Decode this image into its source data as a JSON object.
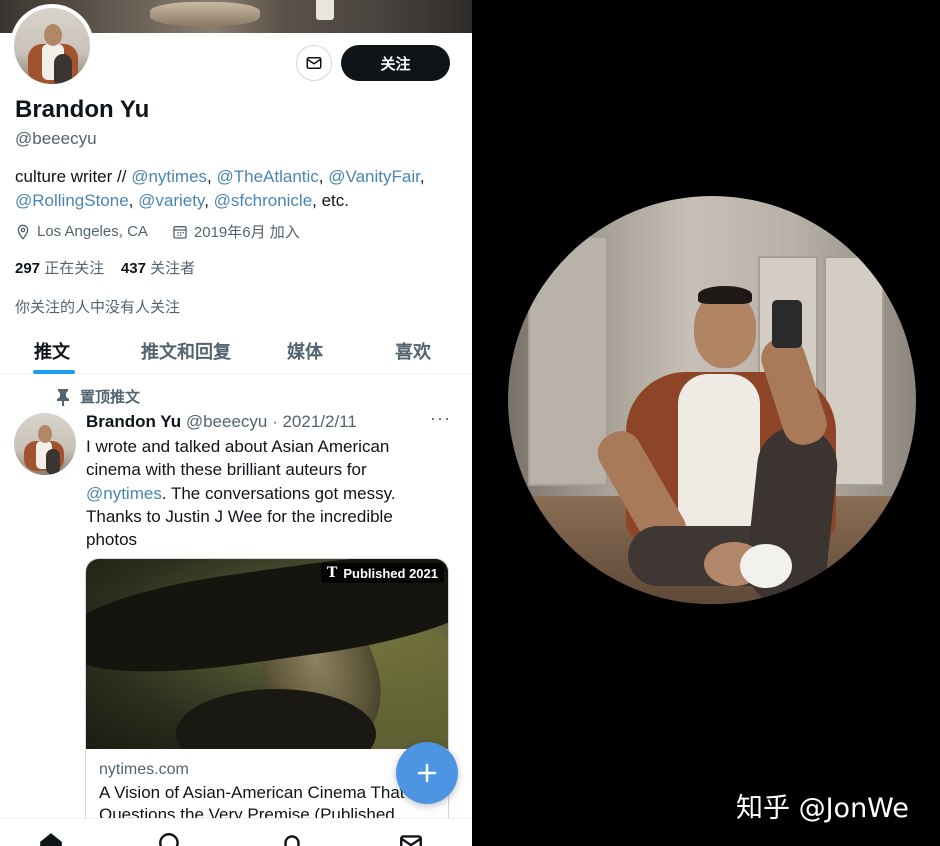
{
  "profile": {
    "name": "Brandon Yu",
    "handle": "@beeecyu",
    "follow_label": "关注",
    "bio_parts": {
      "p1": "culture writer // ",
      "l1": "@nytimes",
      "s1": ", ",
      "l2": "@TheAtlantic",
      "s2": ", ",
      "l3": "@VanityFair",
      "s3": ",",
      "l4": "@RollingStone",
      "s4": ", ",
      "l5": "@variety",
      "s5": ", ",
      "l6": "@sfchronicle",
      "s6": ", etc."
    },
    "location": "Los Angeles, CA",
    "joined": "2019年6月 加入",
    "following_count": "297",
    "following_label": "正在关注",
    "followers_count": "437",
    "followers_label": "关注者",
    "followed_note": "你关注的人中没有人关注"
  },
  "tabs": [
    "推文",
    "推文和回复",
    "媒体",
    "喜欢"
  ],
  "tweet": {
    "pinned_label": "置顶推文",
    "author": "Brandon Yu",
    "meta": "@beeecyu · 2021/2/11",
    "text1": "I wrote and talked about Asian American cinema with these brilliant auteurs for ",
    "link": "@nytimes",
    "text2": ". The conversations got messy. Thanks to Justin J Wee for the incredible photos",
    "card": {
      "badge_logo": "T",
      "badge_text": "Published 2021",
      "domain": "nytimes.com",
      "title": "A Vision of Asian-American Cinema That Questions the Very Premise (Published..."
    }
  },
  "watermark": "知乎 @JonWe",
  "colors": {
    "link": "#4a86b5",
    "accent": "#1d9bf0",
    "fab": "#4d95e2"
  },
  "icons": [
    "mail-icon",
    "location-icon",
    "calendar-icon",
    "pin-icon",
    "more-icon",
    "plus-icon",
    "home-icon",
    "search-icon",
    "notifications-icon",
    "messages-icon"
  ]
}
